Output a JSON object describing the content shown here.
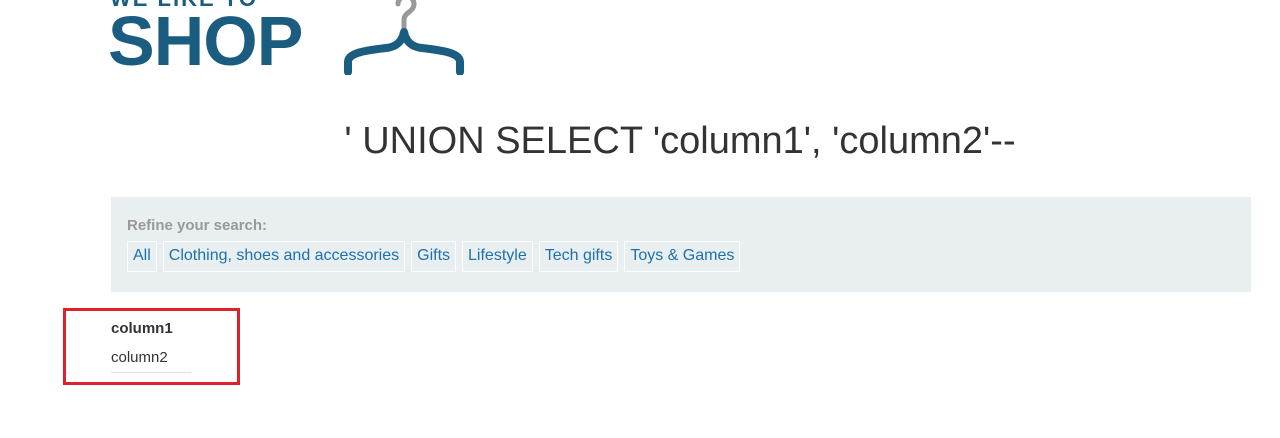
{
  "logo": {
    "sub_text": "WE LIKE TO",
    "text": "SHOP",
    "icon": "hanger-icon",
    "color": "#1b5d80"
  },
  "search": {
    "title": "' UNION SELECT 'column1', 'column2'--"
  },
  "filters": {
    "label": "Refine your search:",
    "items": [
      {
        "label": "All"
      },
      {
        "label": "Clothing, shoes and accessories"
      },
      {
        "label": "Gifts"
      },
      {
        "label": "Lifestyle"
      },
      {
        "label": "Tech gifts"
      },
      {
        "label": "Toys & Games"
      }
    ]
  },
  "results": [
    {
      "name": "column1",
      "value": "column2"
    }
  ],
  "colors": {
    "link": "#1a72b0",
    "panel_bg": "#e9eef0",
    "highlight": "#e0202a"
  }
}
